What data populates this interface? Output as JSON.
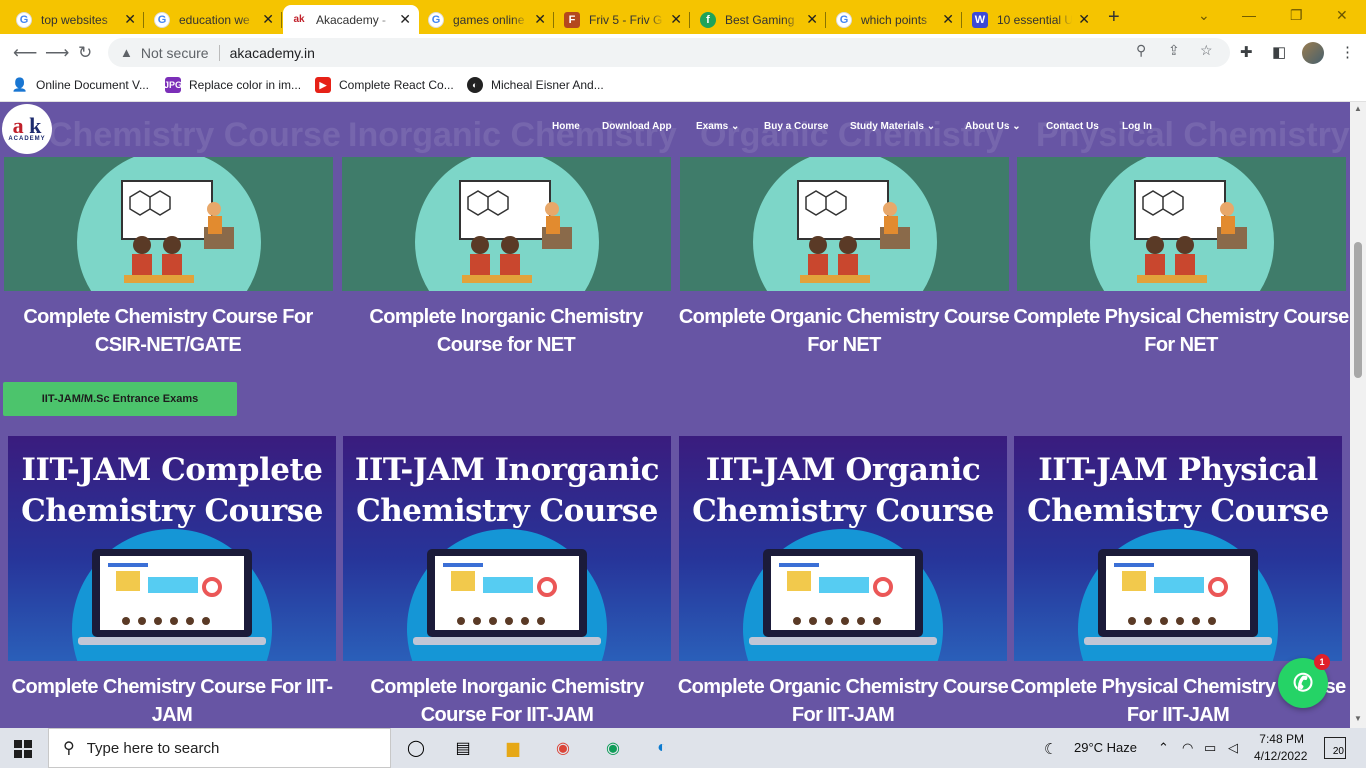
{
  "browser": {
    "tabs": [
      {
        "title": "top websites",
        "favicon": "google-icon"
      },
      {
        "title": "education we",
        "favicon": "google-icon"
      },
      {
        "title": "Akacademy -",
        "favicon": "akacademy-icon",
        "active": true
      },
      {
        "title": "games online",
        "favicon": "google-icon"
      },
      {
        "title": "Friv 5 - Friv G",
        "favicon": "friv-icon"
      },
      {
        "title": "Best Gaming",
        "favicon": "fandom-icon"
      },
      {
        "title": "which points",
        "favicon": "google-icon"
      },
      {
        "title": "10 essential U",
        "favicon": "w-icon"
      }
    ],
    "security_label": "Not secure",
    "url": "akacademy.in",
    "bookmarks": [
      {
        "label": "Online Document V...",
        "icon": "document-viewer-icon"
      },
      {
        "label": "Replace color in im...",
        "icon": "jpg-icon"
      },
      {
        "label": "Complete React Co...",
        "icon": "youtube-icon"
      },
      {
        "label": "Micheal Eisner And...",
        "icon": "site-icon"
      }
    ]
  },
  "site": {
    "logo_text": "ak",
    "logo_sub": "ACADEMY",
    "nav": [
      "Home",
      "Download App",
      "Exams",
      "Buy a Course",
      "Study Materials",
      "About Us",
      "Contact Us",
      "Log In"
    ],
    "ghost_titles": [
      "Chemistry Course",
      "Inorganic Chemistry",
      "Organic Chemistry",
      "Physical Chemistry"
    ],
    "net_courses": [
      {
        "title": "Complete Chemistry Course For CSIR-NET/GATE"
      },
      {
        "title": "Complete Inorganic Chemistry Course for NET"
      },
      {
        "title": "Complete Organic Chemistry Course For NET"
      },
      {
        "title": "Complete Physical Chemistry Course For NET"
      }
    ],
    "section_button": "IIT-JAM/M.Sc Entrance Exams",
    "jam_courses": [
      {
        "banner": "IIT-JAM Complete Chemistry Course",
        "title": "Complete Chemistry Course For IIT-JAM"
      },
      {
        "banner": "IIT-JAM Inorganic Chemistry Course",
        "title": "Complete Inorganic Chemistry Course For IIT-JAM"
      },
      {
        "banner": "IIT-JAM Organic Chemistry Course",
        "title": "Complete Organic Chemistry Course For IIT-JAM"
      },
      {
        "banner": "IIT-JAM Physical Chemistry Course",
        "title": "Complete Physical Chemistry Course For IIT-JAM"
      }
    ],
    "whatsapp_badge": "1"
  },
  "taskbar": {
    "search_placeholder": "Type here to search",
    "weather": "29°C  Haze",
    "time": "7:48 PM",
    "date": "4/12/2022",
    "notifications": "20"
  },
  "colors": {
    "page_bg": "#6755a4",
    "tabstrip": "#f5c400",
    "section_button": "#4cc46c"
  }
}
